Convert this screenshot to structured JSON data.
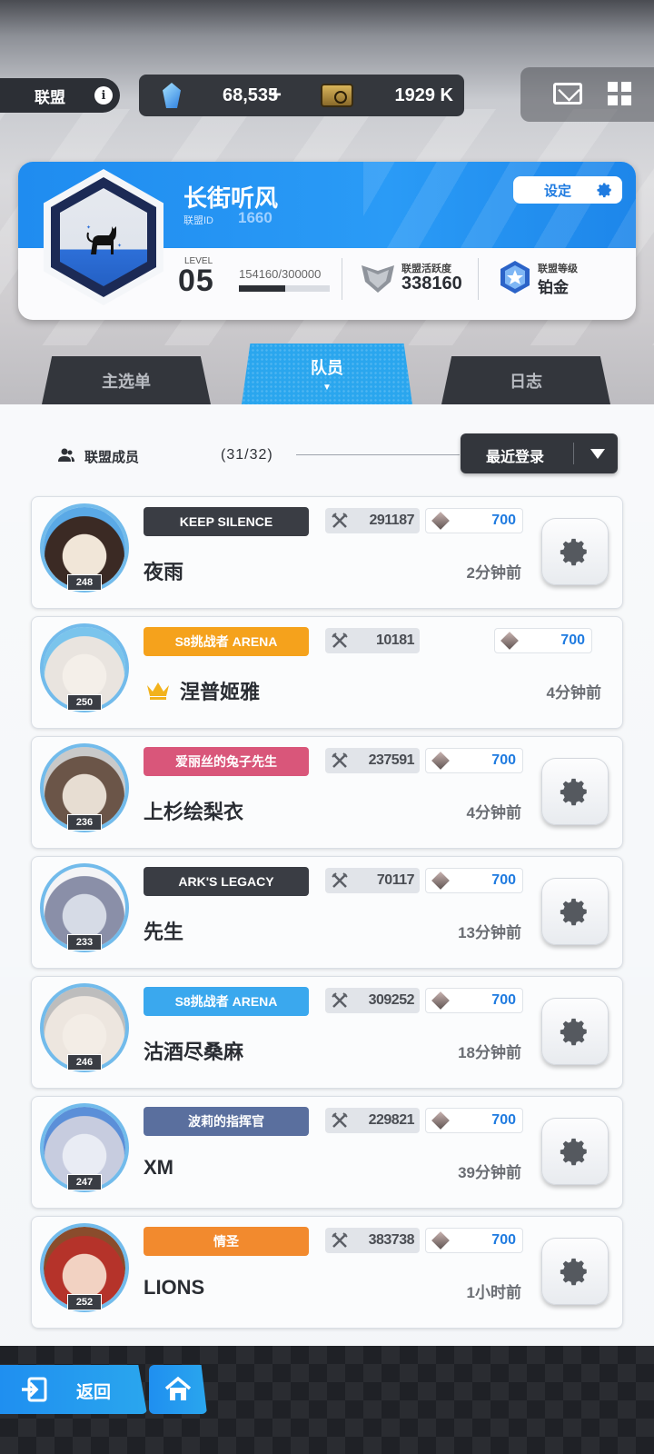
{
  "topbar": {
    "alliance_label": "联盟",
    "info_glyph": "i",
    "gems": "68,535",
    "gems_plus": "+",
    "credits": "1929 K",
    "icons": [
      "gem-icon",
      "ticket-icon",
      "mail-icon",
      "grid-icon"
    ]
  },
  "alliance": {
    "name": "长街听风",
    "id_label": "联盟ID",
    "id": "1660",
    "settings_label": "设定",
    "level_label": "LEVEL",
    "level": "05",
    "exp_text": "154160/300000",
    "exp_progress": 0.5139,
    "activity_label": "联盟活跃度",
    "activity": "338160",
    "rank_label": "联盟等级",
    "rank": "铂金"
  },
  "tabs": [
    {
      "label": "主选单",
      "active": false
    },
    {
      "label": "队员",
      "active": true
    },
    {
      "label": "日志",
      "active": false
    }
  ],
  "members_header": {
    "label": "联盟成员",
    "count": "(31/32)",
    "sort_label": "最近登录"
  },
  "members": [
    {
      "name": "夜雨",
      "level": "248",
      "title": "KEEP SILENCE",
      "title_color": "#3a3d44",
      "power": "291187",
      "contribution": "700",
      "last_login": "2分钟前",
      "leader": false
    },
    {
      "name": "涅普姬雅",
      "level": "250",
      "title": "S8挑战者 ARENA",
      "title_color": "#f5a21c",
      "power": "10181",
      "contribution": "700",
      "last_login": "4分钟前",
      "leader": true
    },
    {
      "name": "上杉绘梨衣",
      "level": "236",
      "title": "爱丽丝的兔子先生",
      "title_color": "#d9567a",
      "power": "237591",
      "contribution": "700",
      "last_login": "4分钟前",
      "leader": false
    },
    {
      "name": "先生",
      "level": "233",
      "title": "ARK'S LEGACY",
      "title_color": "#3a3d44",
      "power": "70117",
      "contribution": "700",
      "last_login": "13分钟前",
      "leader": false
    },
    {
      "name": "沽酒尽桑麻",
      "level": "246",
      "title": "S8挑战者 ARENA",
      "title_color": "#3aa8ee",
      "power": "309252",
      "contribution": "700",
      "last_login": "18分钟前",
      "leader": false
    },
    {
      "name": "XM",
      "level": "247",
      "title": "波莉的指挥官",
      "title_color": "#5a6f9e",
      "power": "229821",
      "contribution": "700",
      "last_login": "39分钟前",
      "leader": false
    },
    {
      "name": "LIONS",
      "level": "252",
      "title": "情圣",
      "title_color": "#f28a2e",
      "power": "383738",
      "contribution": "700",
      "last_login": "1小时前",
      "leader": false
    }
  ],
  "bottom": {
    "back_label": "返回",
    "icons": [
      "exit-icon",
      "home-icon"
    ]
  },
  "colors": {
    "accent": "#2aa6ee",
    "dark": "#33363c",
    "contribution_text": "#1f7be0"
  }
}
